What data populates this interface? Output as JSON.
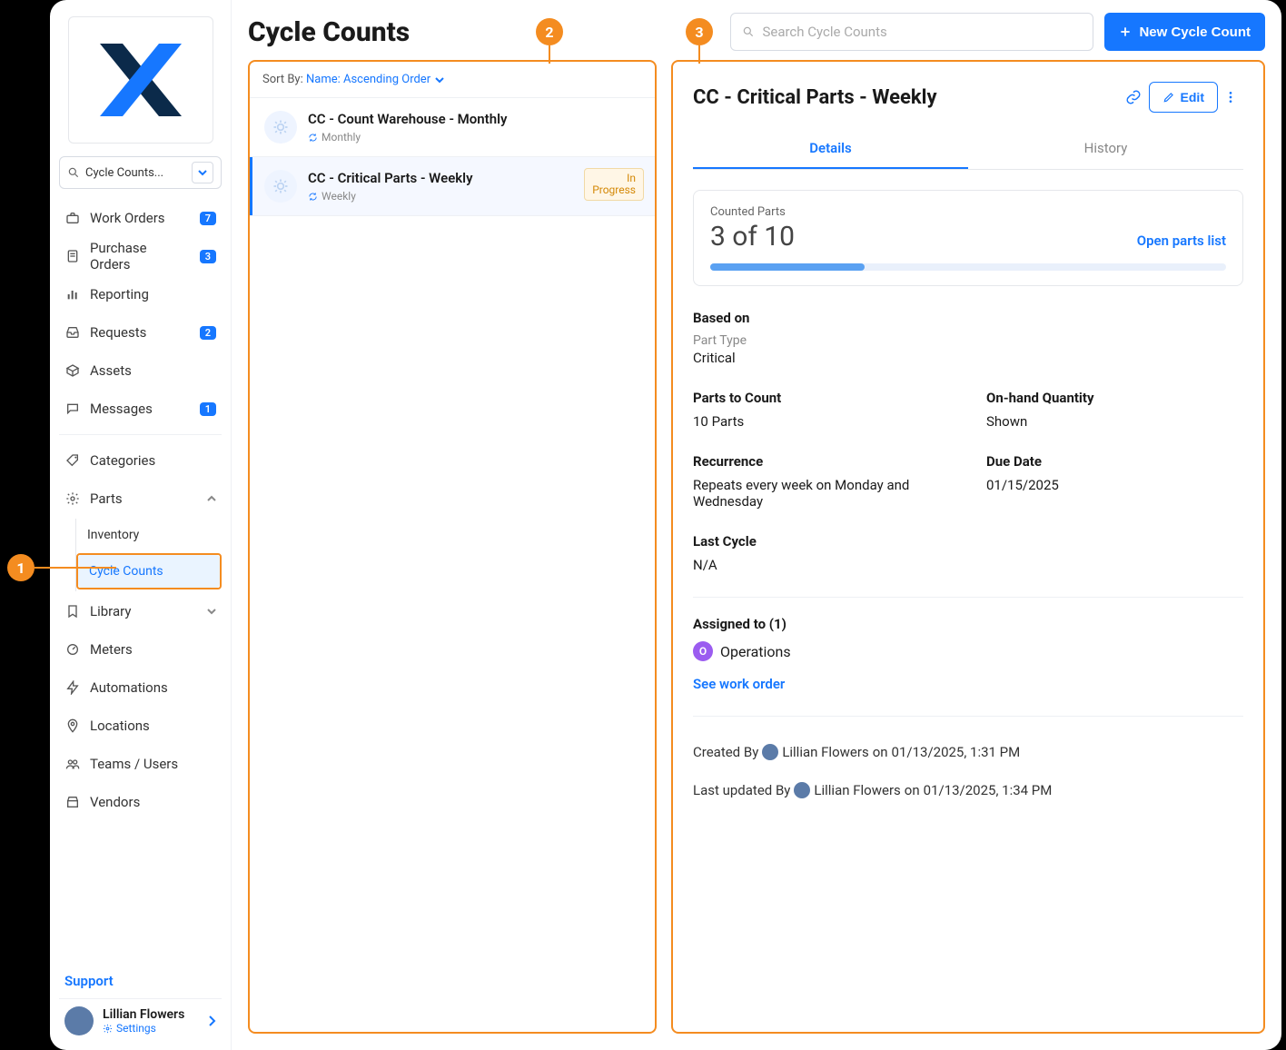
{
  "sidebar": {
    "selector_label": "Cycle Counts...",
    "items": [
      {
        "label": "Work Orders",
        "badge": "7"
      },
      {
        "label": "Purchase Orders",
        "badge": "3"
      },
      {
        "label": "Reporting",
        "badge": null
      },
      {
        "label": "Requests",
        "badge": "2"
      },
      {
        "label": "Assets",
        "badge": null
      },
      {
        "label": "Messages",
        "badge": "1"
      }
    ],
    "secondary": [
      {
        "label": "Categories"
      },
      {
        "label": "Parts",
        "expanded": true,
        "children": [
          {
            "label": "Inventory"
          },
          {
            "label": "Cycle Counts",
            "active": true
          }
        ]
      },
      {
        "label": "Library"
      },
      {
        "label": "Meters"
      },
      {
        "label": "Automations"
      },
      {
        "label": "Locations"
      },
      {
        "label": "Teams / Users"
      },
      {
        "label": "Vendors"
      }
    ],
    "support_label": "Support",
    "user": {
      "name": "Lillian Flowers",
      "sub": "Settings"
    }
  },
  "page": {
    "title": "Cycle Counts",
    "search_placeholder": "Search Cycle Counts",
    "new_button": "New Cycle Count"
  },
  "list": {
    "sort_label": "Sort By:",
    "sort_value": "Name: Ascending Order",
    "items": [
      {
        "title": "CC - Count Warehouse - Monthly",
        "cadence": "Monthly",
        "status": null
      },
      {
        "title": "CC - Critical Parts - Weekly",
        "cadence": "Weekly",
        "status": "In Progress",
        "selected": true
      }
    ]
  },
  "detail": {
    "title": "CC - Critical Parts - Weekly",
    "edit_label": "Edit",
    "tabs": {
      "details": "Details",
      "history": "History"
    },
    "counted": {
      "label": "Counted Parts",
      "value": "3 of 10",
      "link": "Open parts list",
      "progress_pct": 30
    },
    "based_on": {
      "label": "Based on",
      "subtype": "Part Type",
      "value": "Critical"
    },
    "parts_to_count": {
      "label": "Parts to Count",
      "value": "10 Parts"
    },
    "on_hand": {
      "label": "On-hand Quantity",
      "value": "Shown"
    },
    "recurrence": {
      "label": "Recurrence",
      "value": "Repeats every week on Monday and Wednesday"
    },
    "due_date": {
      "label": "Due Date",
      "value": "01/15/2025"
    },
    "last_cycle": {
      "label": "Last Cycle",
      "value": "N/A"
    },
    "assigned": {
      "label": "Assigned to (1)",
      "initial": "O",
      "team": "Operations"
    },
    "see_wo": "See work order",
    "created": {
      "prefix": "Created By",
      "name": "Lillian Flowers",
      "on": "on",
      "date": "01/13/2025, 1:31 PM"
    },
    "updated": {
      "prefix": "Last updated By",
      "name": "Lillian Flowers",
      "on": "on",
      "date": "01/13/2025, 1:34 PM"
    }
  },
  "annotations": {
    "a1": "1",
    "a2": "2",
    "a3": "3"
  }
}
